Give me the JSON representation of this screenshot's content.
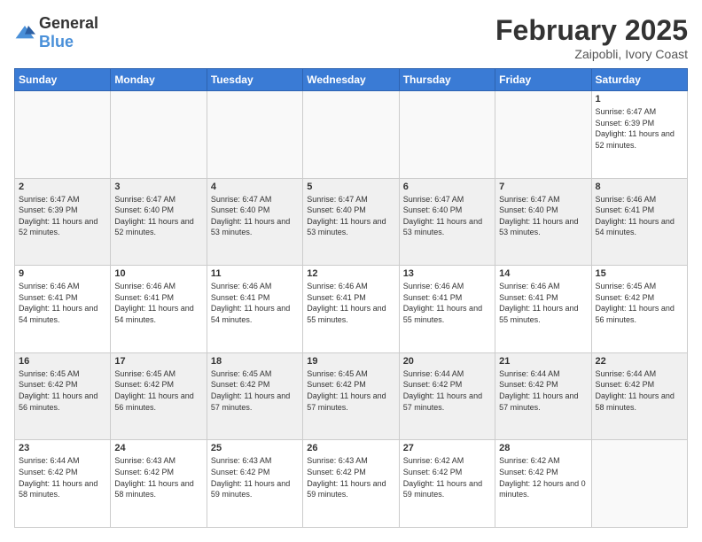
{
  "header": {
    "logo_general": "General",
    "logo_blue": "Blue",
    "month_title": "February 2025",
    "location": "Zaipobli, Ivory Coast"
  },
  "weekdays": [
    "Sunday",
    "Monday",
    "Tuesday",
    "Wednesday",
    "Thursday",
    "Friday",
    "Saturday"
  ],
  "weeks": [
    {
      "stripe": false,
      "days": [
        {
          "num": "",
          "info": ""
        },
        {
          "num": "",
          "info": ""
        },
        {
          "num": "",
          "info": ""
        },
        {
          "num": "",
          "info": ""
        },
        {
          "num": "",
          "info": ""
        },
        {
          "num": "",
          "info": ""
        },
        {
          "num": "1",
          "info": "Sunrise: 6:47 AM\nSunset: 6:39 PM\nDaylight: 11 hours and 52 minutes."
        }
      ]
    },
    {
      "stripe": true,
      "days": [
        {
          "num": "2",
          "info": "Sunrise: 6:47 AM\nSunset: 6:39 PM\nDaylight: 11 hours and 52 minutes."
        },
        {
          "num": "3",
          "info": "Sunrise: 6:47 AM\nSunset: 6:40 PM\nDaylight: 11 hours and 52 minutes."
        },
        {
          "num": "4",
          "info": "Sunrise: 6:47 AM\nSunset: 6:40 PM\nDaylight: 11 hours and 53 minutes."
        },
        {
          "num": "5",
          "info": "Sunrise: 6:47 AM\nSunset: 6:40 PM\nDaylight: 11 hours and 53 minutes."
        },
        {
          "num": "6",
          "info": "Sunrise: 6:47 AM\nSunset: 6:40 PM\nDaylight: 11 hours and 53 minutes."
        },
        {
          "num": "7",
          "info": "Sunrise: 6:47 AM\nSunset: 6:40 PM\nDaylight: 11 hours and 53 minutes."
        },
        {
          "num": "8",
          "info": "Sunrise: 6:46 AM\nSunset: 6:41 PM\nDaylight: 11 hours and 54 minutes."
        }
      ]
    },
    {
      "stripe": false,
      "days": [
        {
          "num": "9",
          "info": "Sunrise: 6:46 AM\nSunset: 6:41 PM\nDaylight: 11 hours and 54 minutes."
        },
        {
          "num": "10",
          "info": "Sunrise: 6:46 AM\nSunset: 6:41 PM\nDaylight: 11 hours and 54 minutes."
        },
        {
          "num": "11",
          "info": "Sunrise: 6:46 AM\nSunset: 6:41 PM\nDaylight: 11 hours and 54 minutes."
        },
        {
          "num": "12",
          "info": "Sunrise: 6:46 AM\nSunset: 6:41 PM\nDaylight: 11 hours and 55 minutes."
        },
        {
          "num": "13",
          "info": "Sunrise: 6:46 AM\nSunset: 6:41 PM\nDaylight: 11 hours and 55 minutes."
        },
        {
          "num": "14",
          "info": "Sunrise: 6:46 AM\nSunset: 6:41 PM\nDaylight: 11 hours and 55 minutes."
        },
        {
          "num": "15",
          "info": "Sunrise: 6:45 AM\nSunset: 6:42 PM\nDaylight: 11 hours and 56 minutes."
        }
      ]
    },
    {
      "stripe": true,
      "days": [
        {
          "num": "16",
          "info": "Sunrise: 6:45 AM\nSunset: 6:42 PM\nDaylight: 11 hours and 56 minutes."
        },
        {
          "num": "17",
          "info": "Sunrise: 6:45 AM\nSunset: 6:42 PM\nDaylight: 11 hours and 56 minutes."
        },
        {
          "num": "18",
          "info": "Sunrise: 6:45 AM\nSunset: 6:42 PM\nDaylight: 11 hours and 57 minutes."
        },
        {
          "num": "19",
          "info": "Sunrise: 6:45 AM\nSunset: 6:42 PM\nDaylight: 11 hours and 57 minutes."
        },
        {
          "num": "20",
          "info": "Sunrise: 6:44 AM\nSunset: 6:42 PM\nDaylight: 11 hours and 57 minutes."
        },
        {
          "num": "21",
          "info": "Sunrise: 6:44 AM\nSunset: 6:42 PM\nDaylight: 11 hours and 57 minutes."
        },
        {
          "num": "22",
          "info": "Sunrise: 6:44 AM\nSunset: 6:42 PM\nDaylight: 11 hours and 58 minutes."
        }
      ]
    },
    {
      "stripe": false,
      "days": [
        {
          "num": "23",
          "info": "Sunrise: 6:44 AM\nSunset: 6:42 PM\nDaylight: 11 hours and 58 minutes."
        },
        {
          "num": "24",
          "info": "Sunrise: 6:43 AM\nSunset: 6:42 PM\nDaylight: 11 hours and 58 minutes."
        },
        {
          "num": "25",
          "info": "Sunrise: 6:43 AM\nSunset: 6:42 PM\nDaylight: 11 hours and 59 minutes."
        },
        {
          "num": "26",
          "info": "Sunrise: 6:43 AM\nSunset: 6:42 PM\nDaylight: 11 hours and 59 minutes."
        },
        {
          "num": "27",
          "info": "Sunrise: 6:42 AM\nSunset: 6:42 PM\nDaylight: 11 hours and 59 minutes."
        },
        {
          "num": "28",
          "info": "Sunrise: 6:42 AM\nSunset: 6:42 PM\nDaylight: 12 hours and 0 minutes."
        },
        {
          "num": "",
          "info": ""
        }
      ]
    }
  ]
}
